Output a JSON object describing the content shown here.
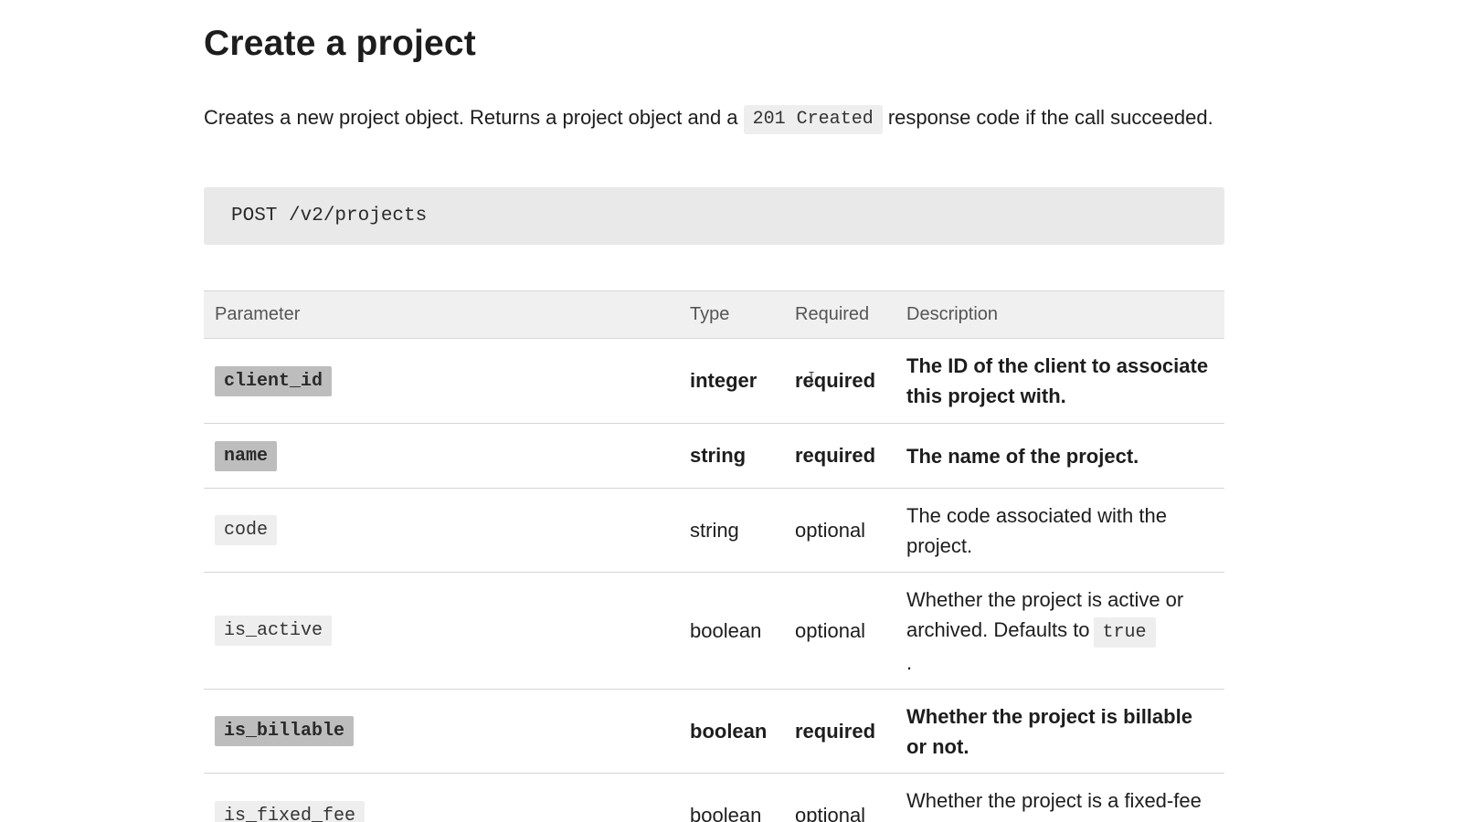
{
  "page": {
    "title": "Create a project",
    "intro_before": "Creates a new project object. Returns a project object and a ",
    "intro_code": "201 Created",
    "intro_after": " response code if the call succeeded.",
    "endpoint": "POST /v2/projects"
  },
  "table": {
    "headers": {
      "parameter": "Parameter",
      "type": "Type",
      "required": "Required",
      "description": "Description"
    },
    "rows": [
      {
        "parameter": "client_id",
        "type": "integer",
        "required": "required",
        "description": "The ID of the client to associate this project with."
      },
      {
        "parameter": "name",
        "type": "string",
        "required": "required",
        "description": "The name of the project."
      },
      {
        "parameter": "code",
        "type": "string",
        "required": "optional",
        "description": "The code associated with the project."
      },
      {
        "parameter": "is_active",
        "type": "boolean",
        "required": "optional",
        "description": "Whether the project is active or archived. Defaults to",
        "description_code": "true",
        "description_end": "."
      },
      {
        "parameter": "is_billable",
        "type": "boolean",
        "required": "required",
        "description": "Whether the project is billable or not."
      },
      {
        "parameter": "is_fixed_fee",
        "type": "boolean",
        "required": "optional",
        "description": "Whether the project is a fixed-fee project or not."
      }
    ]
  }
}
